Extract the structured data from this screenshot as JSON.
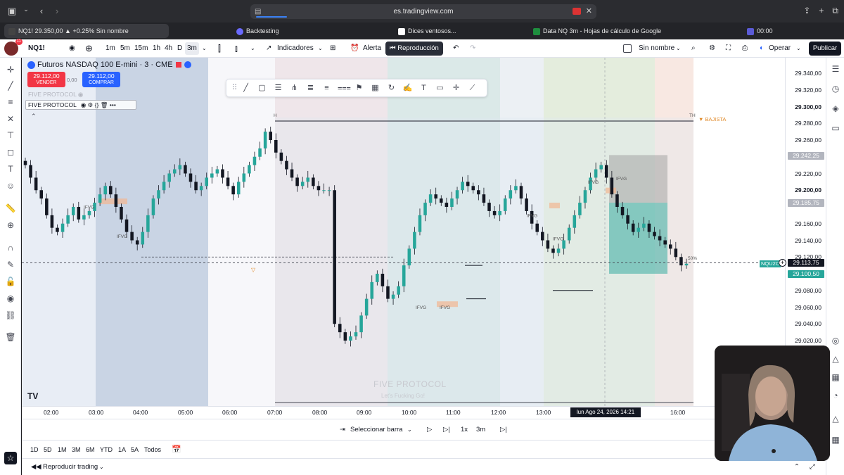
{
  "browser": {
    "url": "es.tradingview.com",
    "tabs": [
      {
        "label": "NQ1! 29.350,00 ▲ +0.25% Sin nombre"
      },
      {
        "label": "Backtesting"
      },
      {
        "label": "Dices ventosos..."
      },
      {
        "label": "Data NQ 3m - Hojas de cálculo de Google"
      },
      {
        "label": "00:00"
      }
    ]
  },
  "toolbar": {
    "avatar_badge": "11",
    "symbol": "NQ1!",
    "intervals": [
      "1m",
      "5m",
      "15m",
      "1h",
      "4h",
      "D",
      "3m"
    ],
    "active_interval": "3m",
    "indicators_label": "Indicadores",
    "alert_label": "Alerta",
    "replay_label": "Reproducción",
    "layout_name": "Sin nombre",
    "trade_label": "Operar",
    "publish_label": "Publicar"
  },
  "chart": {
    "title": "Futuros NASDAQ 100 E-mini · 3 · CME",
    "sell_price": "29.112,00",
    "sell_label": "VENDER",
    "spread": "0,00",
    "buy_price": "29.112,00",
    "buy_label": "COMPRAR",
    "indicator_faded": "FIVE PROTOCOL",
    "indicator_name": "FIVE PROTOCOL",
    "watermark": "FIVE PROTOCOL",
    "watermark_sub": "Let's Fucking Go!",
    "bajista_label": "▼ BAJISTA",
    "label_h": "H",
    "label_th": "TH",
    "label_pct": "50%",
    "nq_tag": "NQU2C"
  },
  "chart_data": {
    "type": "candlestick",
    "instrument": "Futuros NASDAQ 100 E-mini · 3 · CME",
    "y_ticks": [
      "29.340,00",
      "29.320,00",
      "29.300,00",
      "29.280,00",
      "29.260,00",
      "29.220,00",
      "29.200,00",
      "29.160,00",
      "29.140,00",
      "29.120,00",
      "29.080,00",
      "29.060,00",
      "29.040,00",
      "29.020,00"
    ],
    "x_ticks": [
      "02:00",
      "03:00",
      "04:00",
      "05:00",
      "06:00",
      "07:00",
      "08:00",
      "09:00",
      "10:00",
      "11:00",
      "12:00",
      "13:00",
      "16:00"
    ],
    "ylim": [
      29010,
      29350
    ],
    "price_tags": {
      "upper_box": "29.242,25",
      "mid": "29.185,75",
      "current": "29.113,75",
      "entry": "29.100,50"
    },
    "ifvg_labels": [
      "IFVG",
      "IFVG",
      "IFVG",
      "IFVG",
      "IFVG",
      "IFVG",
      "IFVG",
      "IFVG"
    ],
    "cursor_time": "lun Ago 24, 2026   14:21",
    "close_series": [
      29230,
      29215,
      29200,
      29190,
      29170,
      29155,
      29150,
      29160,
      29170,
      29180,
      29165,
      29170,
      29175,
      29185,
      29195,
      29205,
      29195,
      29180,
      29165,
      29150,
      29140,
      29135,
      29150,
      29170,
      29190,
      29200,
      29210,
      29220,
      29225,
      29230,
      29220,
      29210,
      29200,
      29205,
      29215,
      29220,
      29225,
      29215,
      29205,
      29195,
      29210,
      29220,
      29230,
      29240,
      29250,
      29270,
      29260,
      29245,
      29235,
      29225,
      29215,
      29205,
      29210,
      29215,
      29205,
      29200,
      29200,
      29200,
      29040,
      29030,
      29020,
      29025,
      29030,
      29050,
      29070,
      29090,
      29100,
      29085,
      29070,
      29075,
      29085,
      29110,
      29130,
      29150,
      29170,
      29185,
      29195,
      29190,
      29185,
      29180,
      29190,
      29200,
      29210,
      29205,
      29200,
      29195,
      29185,
      29175,
      29170,
      29175,
      29190,
      29200,
      29205,
      29190,
      29175,
      29160,
      29150,
      29140,
      29130,
      29125,
      29130,
      29140,
      29155,
      29170,
      29185,
      29200,
      29215,
      29225,
      29230,
      29215,
      29195,
      29180,
      29170,
      29160,
      29150,
      29155,
      29160,
      29150,
      29145,
      29140,
      29135,
      29130,
      29120,
      29110,
      29112
    ]
  },
  "time_range": [
    "1D",
    "5D",
    "1M",
    "3M",
    "6M",
    "YTD",
    "1A",
    "5A",
    "Todos"
  ],
  "replay": {
    "select_bar": "Seleccionar barra",
    "speed": "1x",
    "interval": "3m"
  },
  "bottom": {
    "replay_trading": "Reproducir trading"
  },
  "colors": {
    "bull": "#26a69a",
    "bear": "#131722",
    "sell": "#f23645",
    "buy": "#2962ff",
    "teal_zone": "#26a69a",
    "bajista": "#e08a2a"
  }
}
